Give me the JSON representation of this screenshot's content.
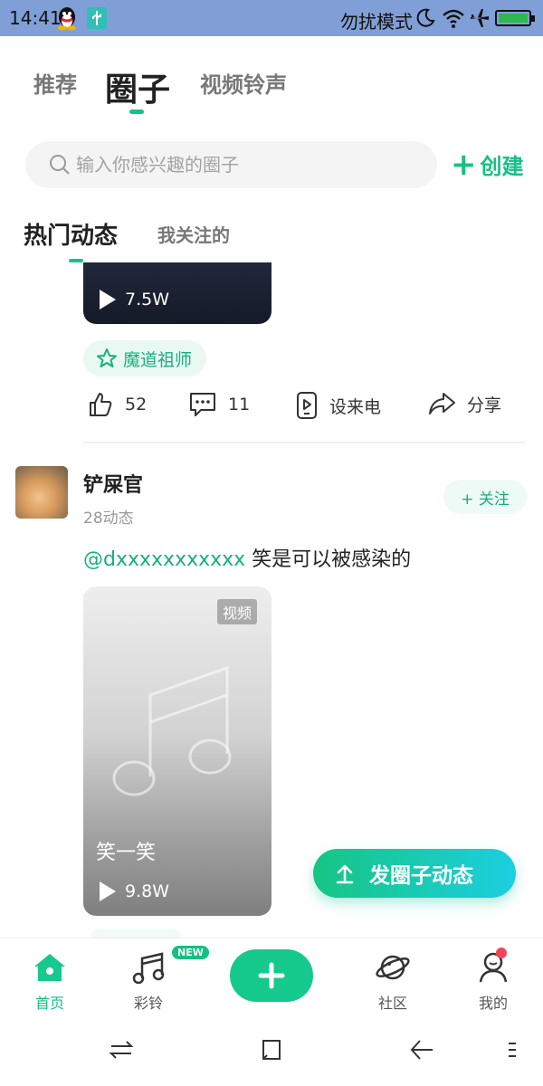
{
  "status_bar": {
    "time": "14:41",
    "mode_text": "勿扰模式",
    "battery_color": "#2db84f"
  },
  "top_tabs": {
    "items": [
      {
        "label": "推荐"
      },
      {
        "label": "圈子"
      },
      {
        "label": "视频铃声"
      }
    ],
    "active_index": 1
  },
  "search": {
    "placeholder": "输入你感兴趣的圈子",
    "value": "",
    "create_label": "创建"
  },
  "feed_tabs": {
    "items": [
      {
        "label": "热门动态"
      },
      {
        "label": "我关注的"
      }
    ],
    "active_index": 0
  },
  "feed": {
    "post1": {
      "play_count": "7.5W",
      "circle_tag": "魔道祖师",
      "likes": "52",
      "comments": "11",
      "set_ringtone_label": "设来电",
      "share_label": "分享"
    },
    "post2": {
      "username": "铲屎官",
      "post_count": "28动态",
      "follow_label": "+ 关注",
      "mention": "@dxxxxxxxxxxx",
      "text": " 笑是可以被感染的",
      "video_badge": "视频",
      "video_title": "笑一笑",
      "play_count": "9.8W"
    }
  },
  "publish_button": {
    "label": "发圈子动态"
  },
  "bottom_nav": {
    "items": [
      {
        "label": "首页",
        "icon": "home-icon"
      },
      {
        "label": "彩铃",
        "icon": "music-note-icon",
        "badge": "NEW"
      },
      {
        "label": "",
        "icon": "plus-icon"
      },
      {
        "label": "社区",
        "icon": "planet-icon"
      },
      {
        "label": "我的",
        "icon": "user-icon"
      }
    ],
    "active_index": 0
  },
  "colors": {
    "accent": "#15c083",
    "status_bar": "#7f9fd6",
    "notification_dot": "#f0445a"
  }
}
